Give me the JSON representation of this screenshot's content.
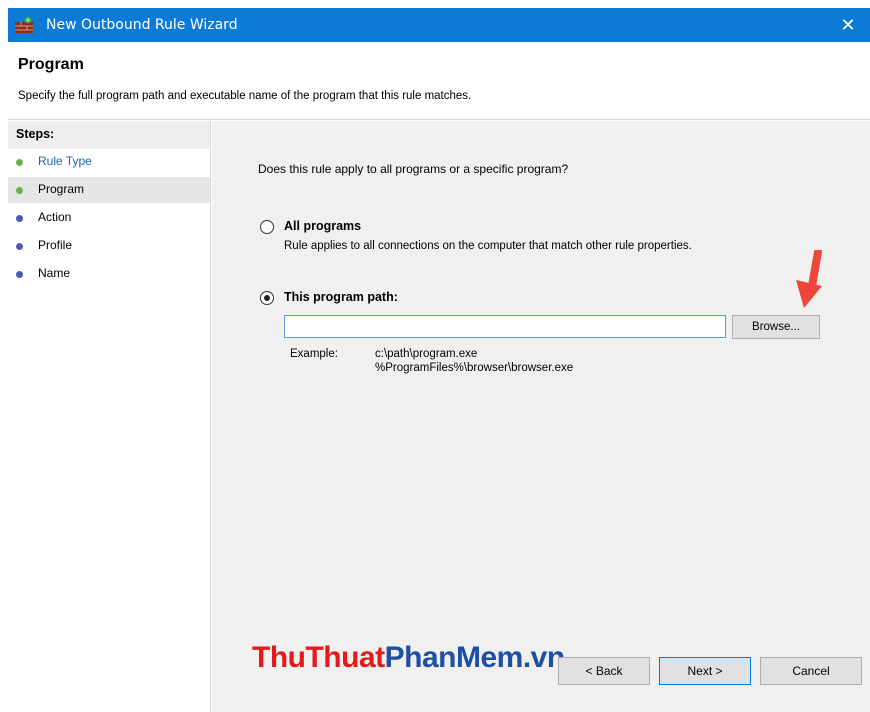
{
  "window": {
    "title": "New Outbound Rule Wizard",
    "close_glyph": "✕"
  },
  "header": {
    "title": "Program",
    "description": "Specify the full program path and executable name of the program that this rule matches."
  },
  "steps": {
    "heading": "Steps:",
    "items": [
      {
        "label": "Rule Type",
        "color": "#1a63b8",
        "dot": "#6ab04c"
      },
      {
        "label": "Program",
        "color": "#000000",
        "dot": "#6ab04c"
      },
      {
        "label": "Action",
        "color": "#000000",
        "dot": "#4a5ab8"
      },
      {
        "label": "Profile",
        "color": "#000000",
        "dot": "#4a5ab8"
      },
      {
        "label": "Name",
        "color": "#000000",
        "dot": "#4a5ab8"
      }
    ]
  },
  "main": {
    "question": "Does this rule apply to all programs or a specific program?",
    "all_programs": {
      "label": "All programs",
      "description": "Rule applies to all connections on the computer that match other rule properties.",
      "selected": false
    },
    "program_path": {
      "label": "This program path:",
      "selected": true,
      "value": "",
      "browse_label": "Browse..."
    },
    "example": {
      "label": "Example:",
      "lines": [
        "c:\\path\\program.exe",
        "%ProgramFiles%\\browser\\browser.exe"
      ]
    }
  },
  "buttons": {
    "back": "< Back",
    "next": "Next >",
    "cancel": "Cancel"
  },
  "watermark": {
    "part1": "ThuThuat",
    "part2": "PhanMem.vn"
  },
  "colors": {
    "titlebar": "#0d7ad6",
    "arrow": "#f0453a",
    "watermark_red": "#e51b1b",
    "watermark_blue": "#1f4fa3"
  }
}
